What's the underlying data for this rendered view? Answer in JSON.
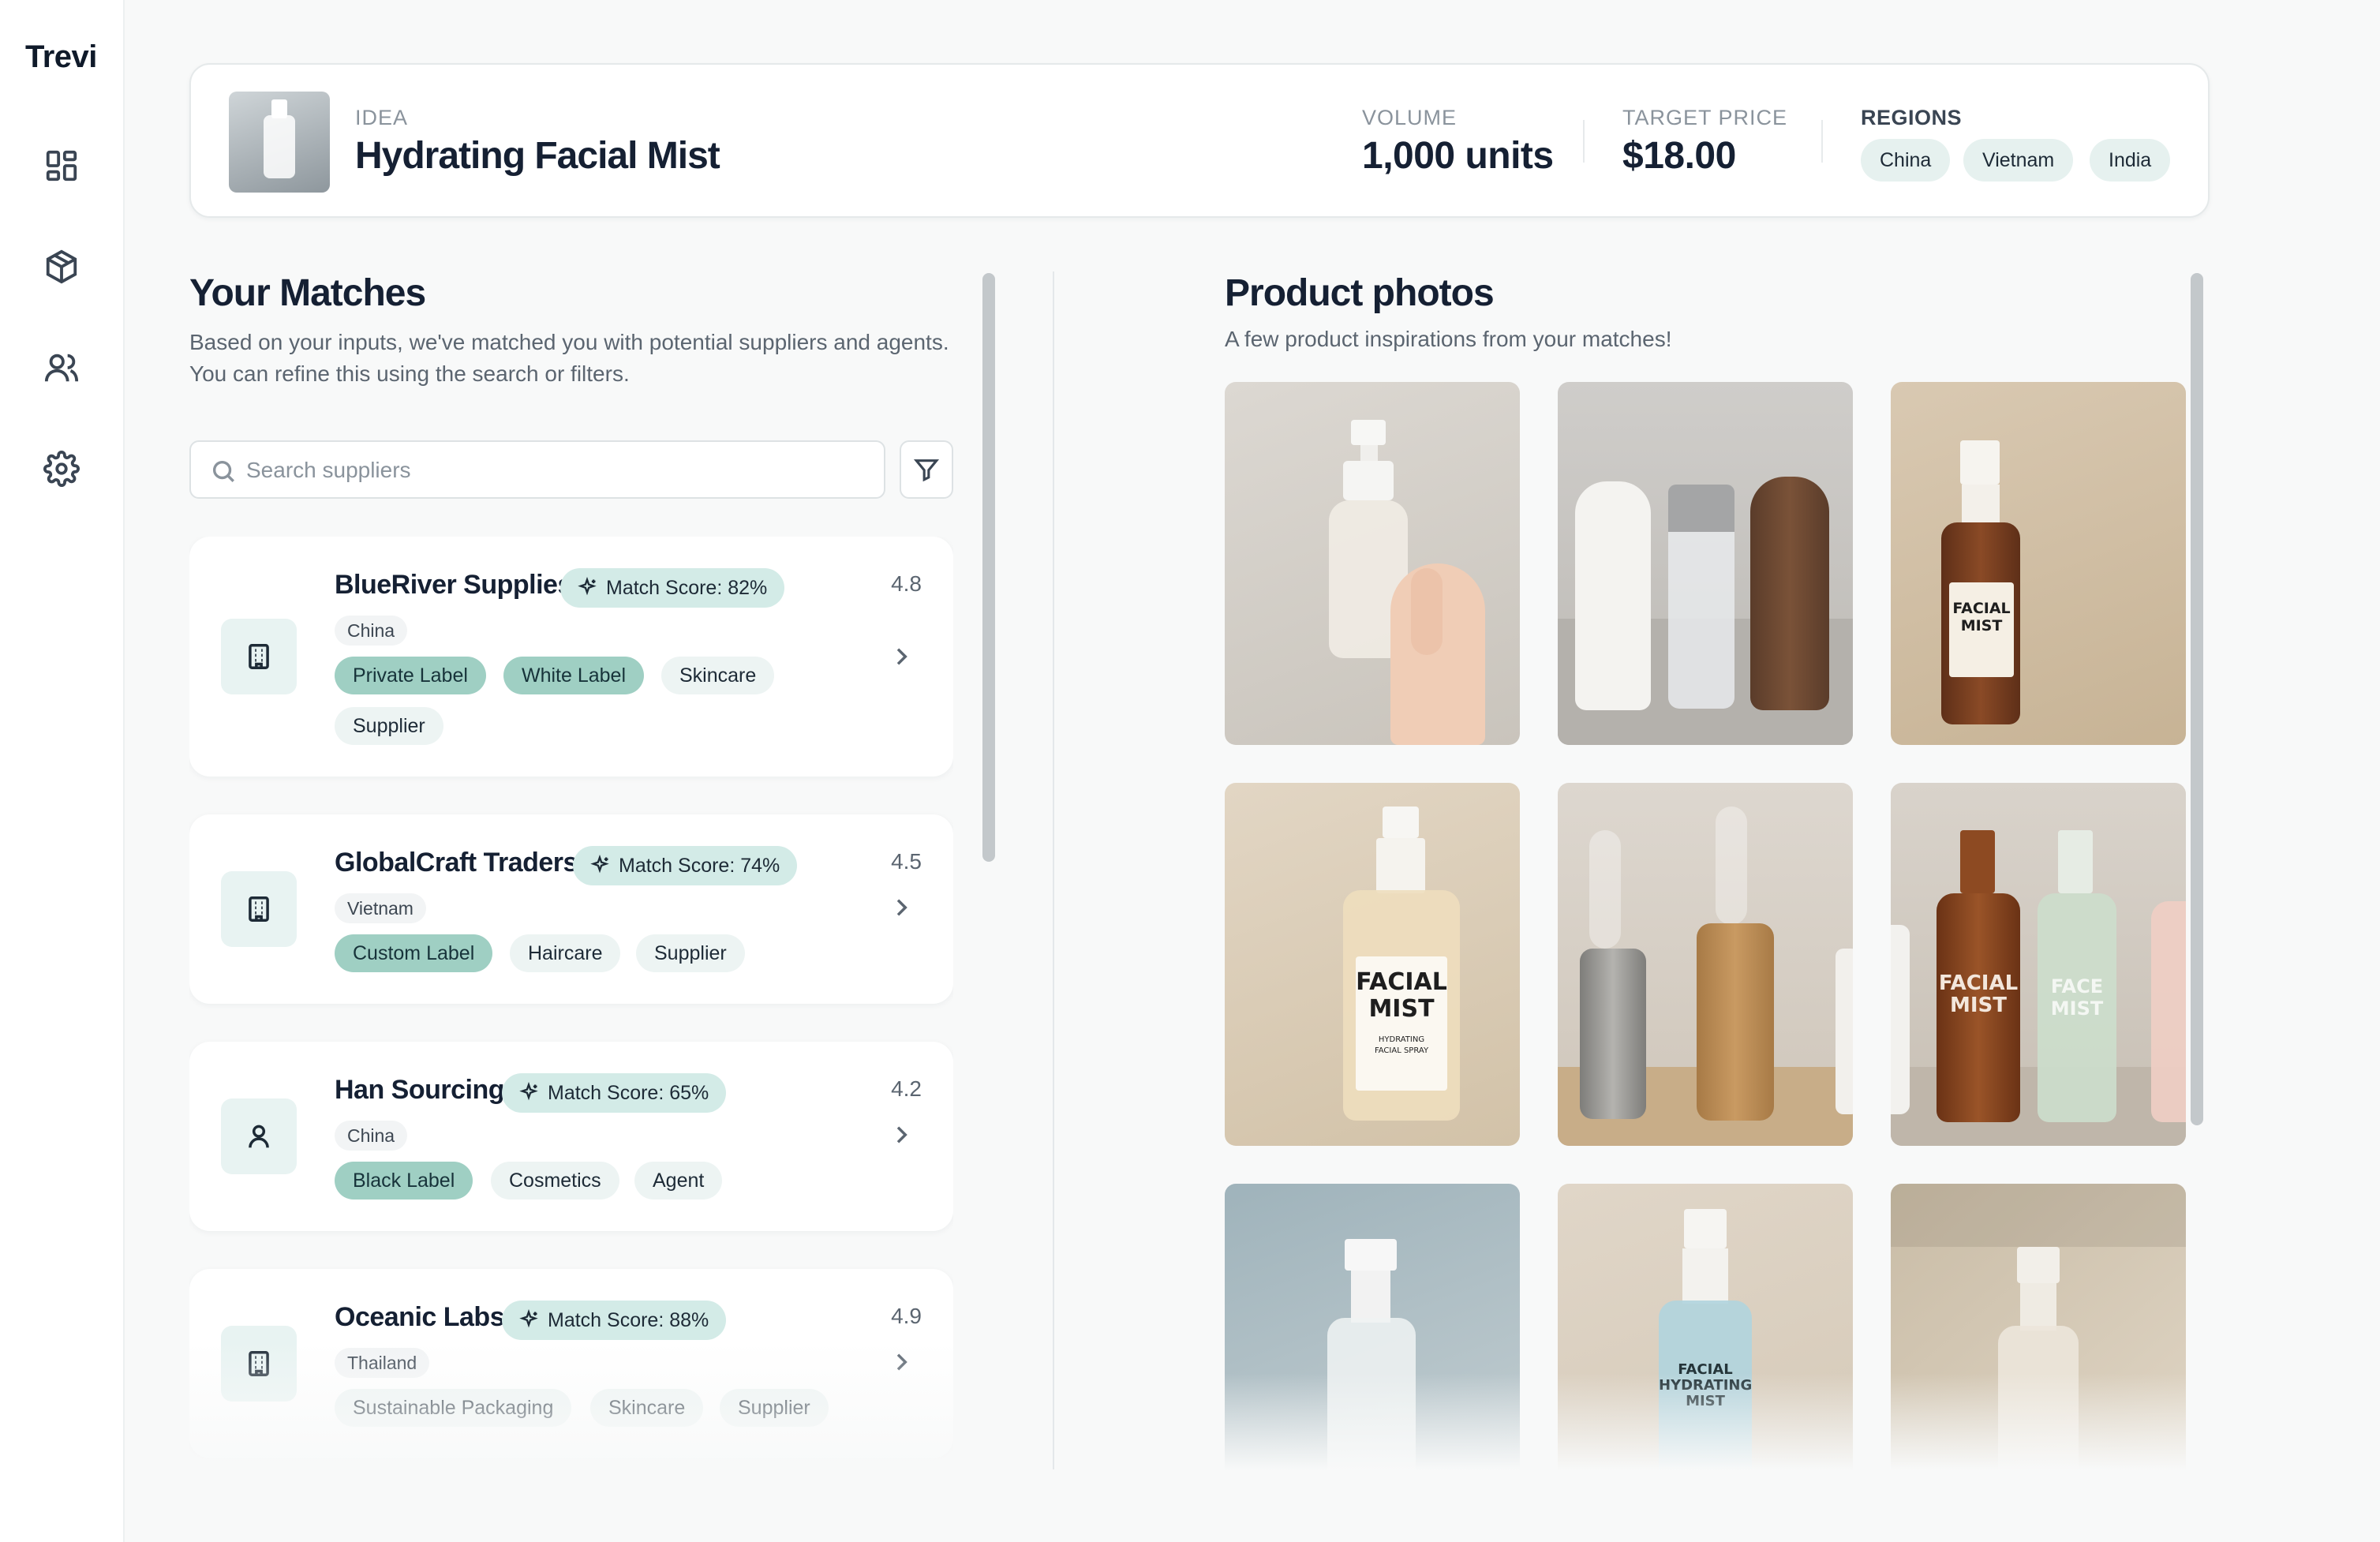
{
  "sidebar": {
    "brand": "Trevi",
    "nav": [
      "dashboard",
      "products",
      "people",
      "settings"
    ]
  },
  "idea": {
    "kicker": "IDEA",
    "title": "Hydrating Facial Mist",
    "volume_label": "VOLUME",
    "volume_value": "1,000 units",
    "price_label": "TARGET PRICE",
    "price_value": "$18.00",
    "regions_label": "REGIONS",
    "regions": [
      "China",
      "Vietnam",
      "India"
    ]
  },
  "matches": {
    "title": "Your Matches",
    "description": "Based on your inputs, we've matched you with potential suppliers and agents. You can refine this using the search or filters.",
    "search_placeholder": "Search suppliers",
    "items": [
      {
        "name": "BlueRiver Supplies",
        "score": "Match Score: 82%",
        "country": "China",
        "rating": "4.8",
        "icon": "building-icon",
        "tags": [
          {
            "label": "Private Label",
            "strong": true
          },
          {
            "label": "White Label",
            "strong": true
          },
          {
            "label": "Skincare",
            "strong": false
          },
          {
            "label": "Supplier",
            "strong": false
          }
        ]
      },
      {
        "name": "GlobalCraft Traders",
        "score": "Match Score: 74%",
        "country": "Vietnam",
        "rating": "4.5",
        "icon": "building-icon",
        "tags": [
          {
            "label": "Custom Label",
            "strong": true
          },
          {
            "label": "Haircare",
            "strong": false
          },
          {
            "label": "Supplier",
            "strong": false
          }
        ]
      },
      {
        "name": "Han Sourcing",
        "score": "Match Score: 65%",
        "country": "China",
        "rating": "4.2",
        "icon": "user-icon",
        "tags": [
          {
            "label": "Black Label",
            "strong": true
          },
          {
            "label": "Cosmetics",
            "strong": false
          },
          {
            "label": "Agent",
            "strong": false
          }
        ]
      },
      {
        "name": "Oceanic Labs",
        "score": "Match Score: 88%",
        "country": "Thailand",
        "rating": "4.9",
        "icon": "building-icon",
        "tags": [
          {
            "label": "Sustainable Packaging",
            "strong": false
          },
          {
            "label": "Skincare",
            "strong": false
          },
          {
            "label": "Supplier",
            "strong": false
          }
        ]
      }
    ]
  },
  "photos": {
    "title": "Product photos",
    "description": "A few product inspirations from your matches!",
    "labels": {
      "p3": [
        "FACIAL",
        "MIST"
      ],
      "p4": [
        "FACIAL",
        "MIST",
        "HYDRATING",
        "FACIAL SPRAY"
      ],
      "p6a": [
        "FACIAL",
        "MIST"
      ],
      "p6b": [
        "FACE",
        "MIST"
      ],
      "p8": [
        "FACIAL",
        "HYDRATING",
        "MIST"
      ]
    }
  },
  "colors": {
    "accent": "#9fcfc3",
    "accent_light": "#d3ebe7",
    "pill": "#e6f1ef",
    "text": "#152033"
  }
}
